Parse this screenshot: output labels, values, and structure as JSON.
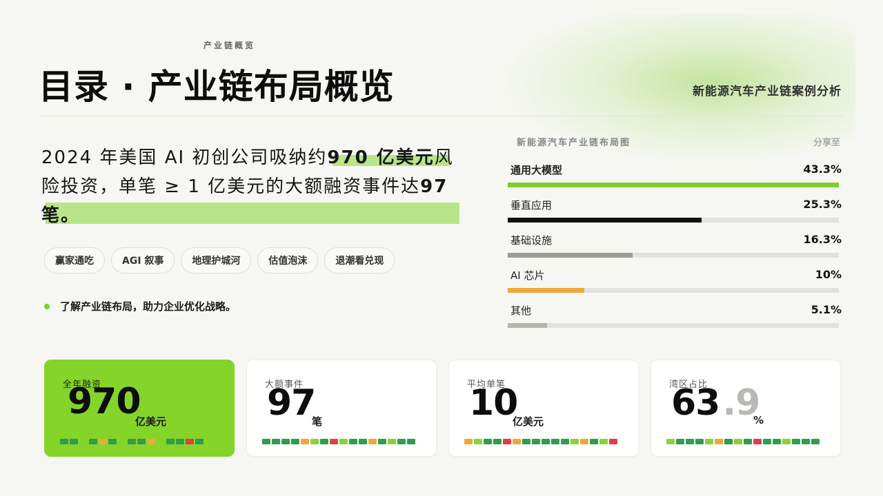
{
  "header": {
    "eyebrow": "产业链概览",
    "title": "目录 · 产业链布局概览",
    "subtitle": "新能源汽车产业链案例分析"
  },
  "lead": {
    "part1": "2024 年美国 AI 初创公司吸纳约",
    "highlight1": "970 亿美元",
    "part2": "风险投资，单笔 ≥ 1 亿美元的大额融资事件达",
    "highlight2": "97",
    "part3": "笔。"
  },
  "tags": [
    "赢家通吃",
    "AGI 叙事",
    "地理护城河",
    "估值泡沫",
    "退潮看兑现"
  ],
  "note": "了解产业链布局，助力企业优化战略。",
  "panel": {
    "title": "新能源汽车产业链布局图",
    "share_label": "分享至",
    "rows": [
      {
        "label": "通用大模型",
        "value": "43.3%",
        "pct": 100,
        "color": "#7fcf2a"
      },
      {
        "label": "垂直应用",
        "value": "25.3%",
        "pct": 58.5,
        "color": "#111111"
      },
      {
        "label": "基础设施",
        "value": "16.3%",
        "pct": 37.7,
        "color": "#9a9c95"
      },
      {
        "label": "AI 芯片",
        "value": "10%",
        "pct": 23.1,
        "color": "#f0a838"
      },
      {
        "label": "其他",
        "value": "5.1%",
        "pct": 11.8,
        "color": "#b5b6b0"
      }
    ]
  },
  "cards": [
    {
      "label": "全年融资",
      "value": "970",
      "frac": "",
      "unit": "亿美元",
      "segs": [
        "#2f9e4a",
        "#2f9e4a",
        "gap",
        "#2f9e4a",
        "#f0a838",
        "#2f9e4a",
        "gap",
        "#2f9e4a",
        "#2f9e4a",
        "#f0a838",
        "gap",
        "#2f9e4a",
        "#2f9e4a",
        "#e04040",
        "#2f9e4a"
      ]
    },
    {
      "label": "大额事件",
      "value": "97",
      "frac": "",
      "unit": "笔",
      "segs": [
        "#2f9e4a",
        "#2f9e4a",
        "#2f9e4a",
        "#2f9e4a",
        "#f0a838",
        "#8bd13a",
        "#2f9e4a",
        "#e04040",
        "#8bd13a",
        "#2f9e4a",
        "#2f9e4a",
        "#f0a838",
        "#2f9e4a",
        "#8bd13a",
        "#2f9e4a",
        "#2f9e4a"
      ]
    },
    {
      "label": "平均单笔",
      "value": "10",
      "frac": "",
      "unit": "亿美元",
      "segs": [
        "#f0a838",
        "#8bd13a",
        "#2f9e4a",
        "#2f9e4a",
        "#e04040",
        "#f0a838",
        "#2f9e4a",
        "#2f9e4a",
        "#2f9e4a",
        "#2f9e4a",
        "#2f9e4a",
        "#8bd13a",
        "#f0a838",
        "#2f9e4a",
        "#8bd13a",
        "#e04040"
      ]
    },
    {
      "label": "湾区占比",
      "value": "63",
      "frac": ".9",
      "unit": "%",
      "segs": [
        "#8bd13a",
        "#2f9e4a",
        "#2f9e4a",
        "#2f9e4a",
        "#8bd13a",
        "#f0a838",
        "#2f9e4a",
        "#8bd13a",
        "#2f9e4a",
        "#e04040",
        "#2f9e4a",
        "#2f9e4a",
        "#8bd13a",
        "#2f9e4a",
        "#2f9e4a",
        "#2f9e4a"
      ]
    }
  ],
  "colors": {
    "accent": "#85d42a",
    "highlight": "#b9e58a"
  }
}
